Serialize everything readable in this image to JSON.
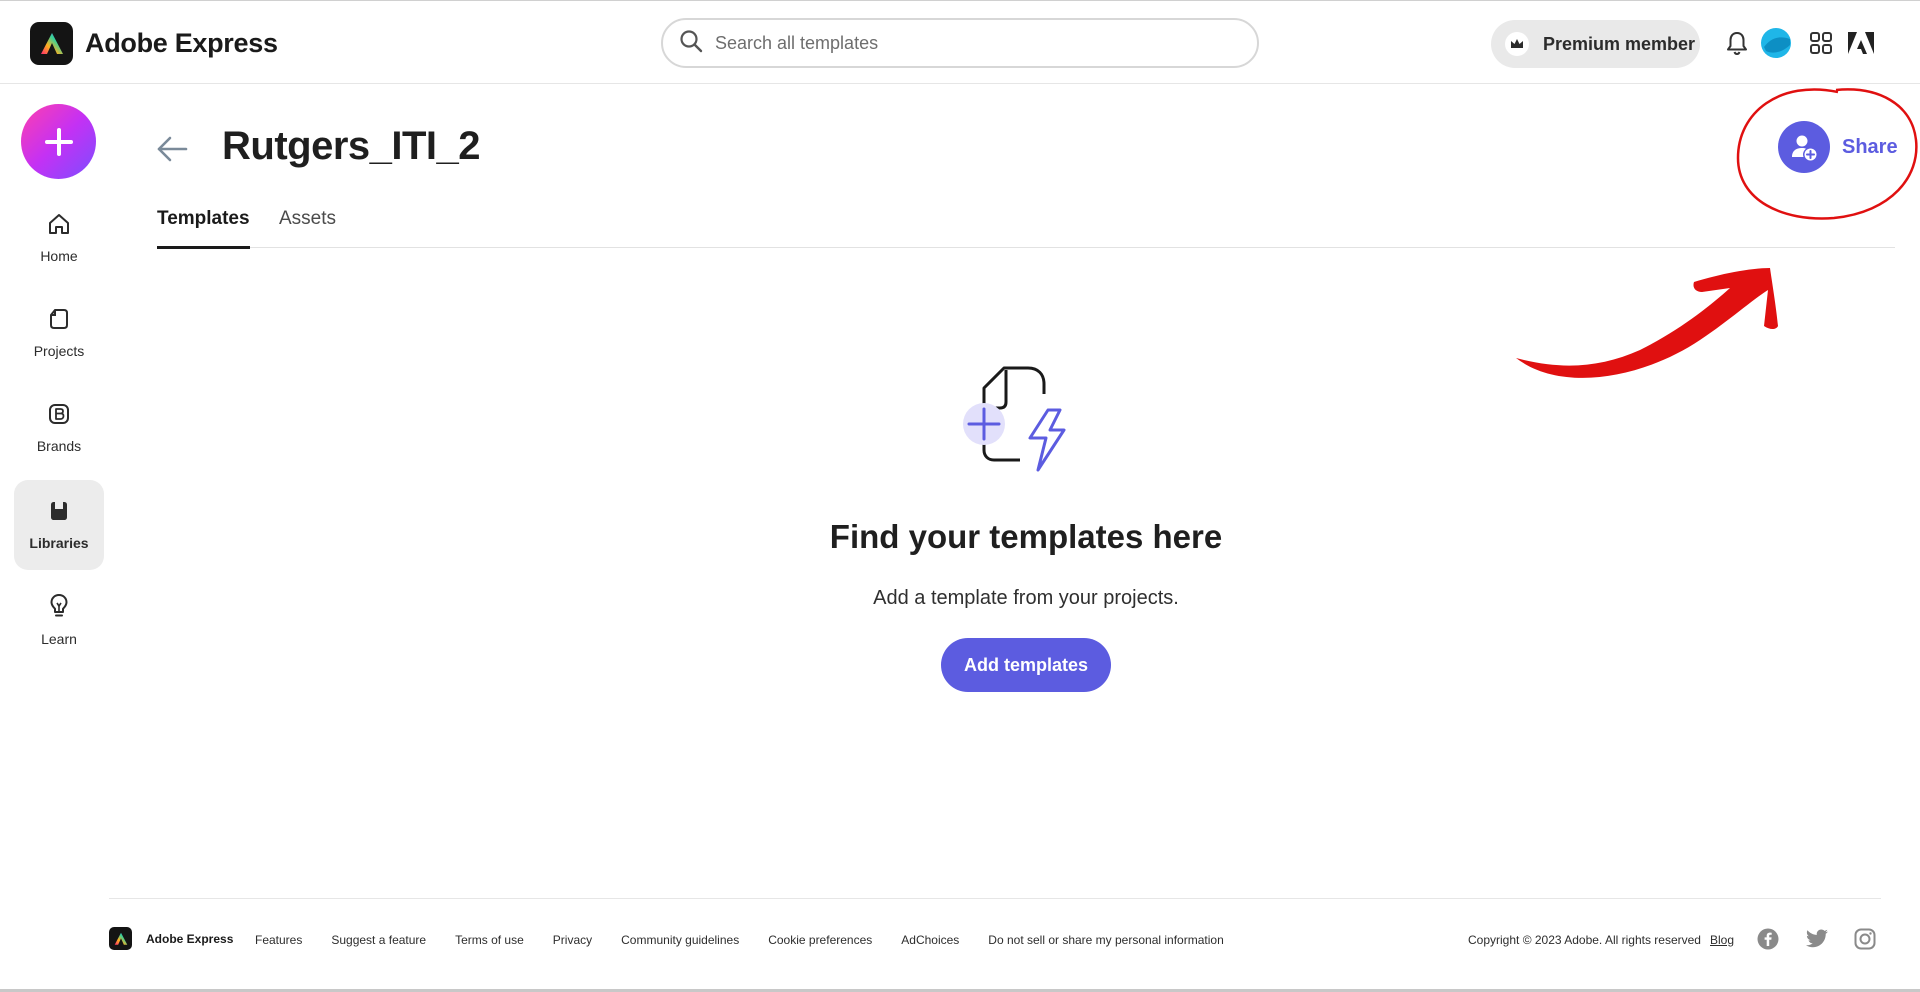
{
  "header": {
    "brand_name": "Adobe Express",
    "search_placeholder": "Search all templates",
    "premium_label": "Premium member",
    "icons": [
      "search-icon",
      "crown-icon",
      "bell-icon",
      "avatar",
      "apps-grid-icon",
      "adobe-logo-icon"
    ]
  },
  "sidebar": {
    "create_icon": "plus-icon",
    "items": [
      {
        "label": "Home",
        "icon": "home-icon"
      },
      {
        "label": "Projects",
        "icon": "projects-icon"
      },
      {
        "label": "Brands",
        "icon": "brands-icon"
      },
      {
        "label": "Libraries",
        "icon": "libraries-icon",
        "active": true
      },
      {
        "label": "Learn",
        "icon": "lightbulb-icon"
      }
    ]
  },
  "main": {
    "title": "Rutgers_ITI_2",
    "share_label": "Share",
    "tabs": [
      {
        "label": "Templates",
        "active": true
      },
      {
        "label": "Assets",
        "active": false
      }
    ],
    "empty_state": {
      "title": "Find your templates here",
      "subtitle": "Add a template from your projects.",
      "button_label": "Add templates"
    }
  },
  "footer": {
    "brand_name": "Adobe Express",
    "links": [
      "Features",
      "Suggest a feature",
      "Terms of use",
      "Privacy",
      "Community guidelines",
      "Cookie preferences",
      "AdChoices",
      "Do not sell or share my personal information"
    ],
    "copyright": "Copyright © 2023 Adobe. All rights reserved",
    "blog_label": "Blog",
    "social": [
      "facebook-icon",
      "twitter-icon",
      "instagram-icon"
    ]
  },
  "colors": {
    "accent": "#5c5ce0",
    "create_gradient": [
      "#ff3fae",
      "#c431f4",
      "#7c4dff"
    ],
    "annotation": "#e01010"
  }
}
